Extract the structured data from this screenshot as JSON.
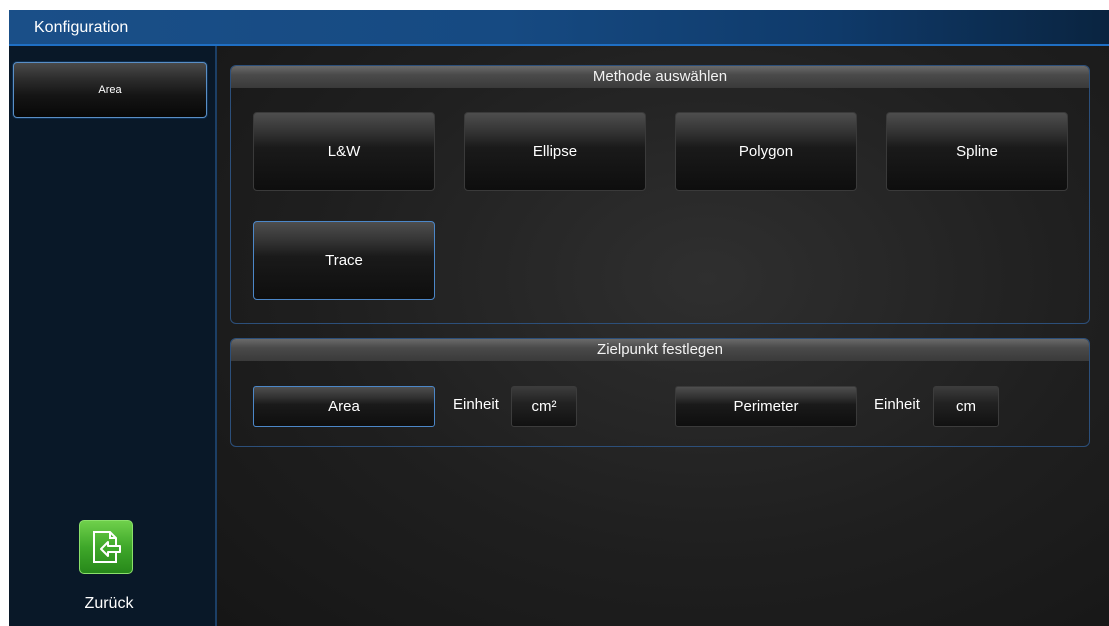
{
  "window": {
    "title": "Konfiguration"
  },
  "sidebar": {
    "items": [
      {
        "label": "Area"
      }
    ],
    "back_button": {
      "label": "Zurück",
      "icon": "exit-arrow-icon"
    }
  },
  "method_panel": {
    "title": "Methode auswählen",
    "buttons": [
      {
        "label": "L&W",
        "selected": false
      },
      {
        "label": "Ellipse",
        "selected": false
      },
      {
        "label": "Polygon",
        "selected": false
      },
      {
        "label": "Spline",
        "selected": false
      },
      {
        "label": "Trace",
        "selected": true
      }
    ]
  },
  "target_panel": {
    "title": "Zielpunkt festlegen",
    "area": {
      "label": "Area",
      "selected": true,
      "unit_label": "Einheit",
      "unit_value": "cm²"
    },
    "perimeter": {
      "label": "Perimeter",
      "selected": false,
      "unit_label": "Einheit",
      "unit_value": "cm"
    }
  },
  "colors": {
    "accent_blue": "#4c87c8",
    "titlebar_blue": "#1a4f88",
    "back_button_green": "#3fa82a"
  }
}
